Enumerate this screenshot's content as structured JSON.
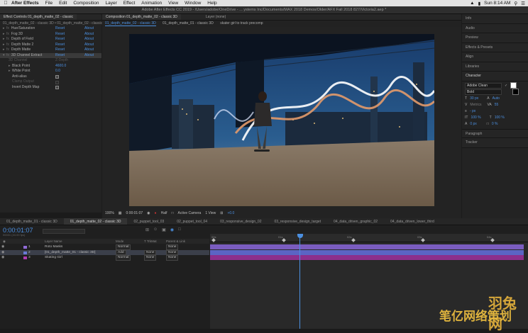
{
  "menubar": {
    "items": [
      "After Effects",
      "File",
      "Edit",
      "Composition",
      "Layer",
      "Effect",
      "Animation",
      "View",
      "Window",
      "Help"
    ],
    "clock": "Sun 8:14 AM"
  },
  "titlebar": "Adobe After Effects CC 2019 - /Users/adobe/OneDrive - ... ystems Inc/Documents/MAX 2018 Demos/Older/AFX Fall 2018 827/Victoria2.aep *",
  "fx_panel": {
    "tab": "Effect Controls 01_depth_matte_02 - classic",
    "subheader": "01_depth_matte_02 - classic 3D • 01_depth_matte_02 - classic 3D",
    "effects": [
      {
        "name": "Hue/Saturation",
        "reset": "Reset",
        "about": "About"
      },
      {
        "name": "Fog 3D",
        "reset": "Reset",
        "about": "About"
      },
      {
        "name": "Depth of Field",
        "reset": "Reset",
        "about": "About"
      },
      {
        "name": "Depth Matte 2",
        "reset": "Reset",
        "about": "About"
      },
      {
        "name": "Depth Matte",
        "reset": "Reset",
        "about": "About"
      },
      {
        "name": "3D Channel Extract",
        "reset": "Reset",
        "about": "About"
      }
    ],
    "params": [
      {
        "name": "3D Channel",
        "value": "Z-Depth"
      },
      {
        "name": "Black Point",
        "value": "4600.0"
      },
      {
        "name": "White Point",
        "value": "0.0"
      },
      {
        "name": "Anti-alias",
        "value": ""
      },
      {
        "name": "Clamp Output",
        "value": ""
      },
      {
        "name": "Invert Depth Map",
        "value": ""
      }
    ]
  },
  "comp_panel": {
    "tab_main": "Composition 01_depth_matte_02 - classic 3D",
    "tab_layer": "Layer (none)",
    "crumbs": [
      "01_depth_matte_02 - classic 3D",
      "01_depth_matte_01 - classic 3D",
      "skater girl to track precomp"
    ],
    "toolbar": {
      "zoom": "100%",
      "timecode": "0:00:01:07",
      "resolution": "Half",
      "camera": "Active Camera",
      "view": "1 View",
      "exposure": "+0.0"
    }
  },
  "right_panel": {
    "sections": [
      "Info",
      "Audio",
      "Preview",
      "Effects & Presets",
      "Align",
      "Libraries",
      "Character",
      "Paragraph",
      "Tracker"
    ],
    "character": {
      "font": "Adobe Clean",
      "style": "Bold",
      "size": "30 px",
      "leading": "Auto",
      "kerning": "Metrics",
      "tracking": "55",
      "stroke": "- px",
      "vscale": "100 %",
      "hscale": "100 %",
      "baseline": "0 px",
      "tsume": "0 %"
    }
  },
  "timeline": {
    "tabs": [
      "01_depth_matte_01 - classic 3D",
      "01_depth_matte_02 - classic 3D",
      "02_puppet_tool_03",
      "02_puppet_tool_04",
      "03_responsive_design_02",
      "03_responsive_design_target",
      "04_data_driven_graphic_02",
      "04_data_driven_lower_third"
    ],
    "timecode": "0:00:01:07",
    "timecode_sub": "00031 (24.00 fps)",
    "search_placeholder": "",
    "header": {
      "layer_name": "Layer Name",
      "mode": "Mode",
      "trkmat": "T TrkMat",
      "parent": "Parent & Link"
    },
    "layers": [
      {
        "num": "1",
        "name": "Roto Masks",
        "mode": "Normal",
        "trkmat": "",
        "parent": "None",
        "label_color": "#8f6ad6"
      },
      {
        "num": "2",
        "name": "[01_depth_matte_01 - classic 3D]",
        "mode": "Add",
        "trkmat": "None",
        "parent": "None",
        "label_color": "#6a7bd6"
      },
      {
        "num": "3",
        "name": "Skating Girl",
        "mode": "Normal",
        "trkmat": "None",
        "parent": "None",
        "label_color": "#b03cb0"
      }
    ],
    "ruler": [
      "00s",
      "01s",
      "02s",
      "03s",
      "04s"
    ],
    "bar_colors": [
      "#7a5cbf",
      "#5b64c4",
      "#8c2f8c"
    ]
  },
  "watermark": {
    "line1": "羽兔网",
    "line2": "笔亿网络策划"
  }
}
